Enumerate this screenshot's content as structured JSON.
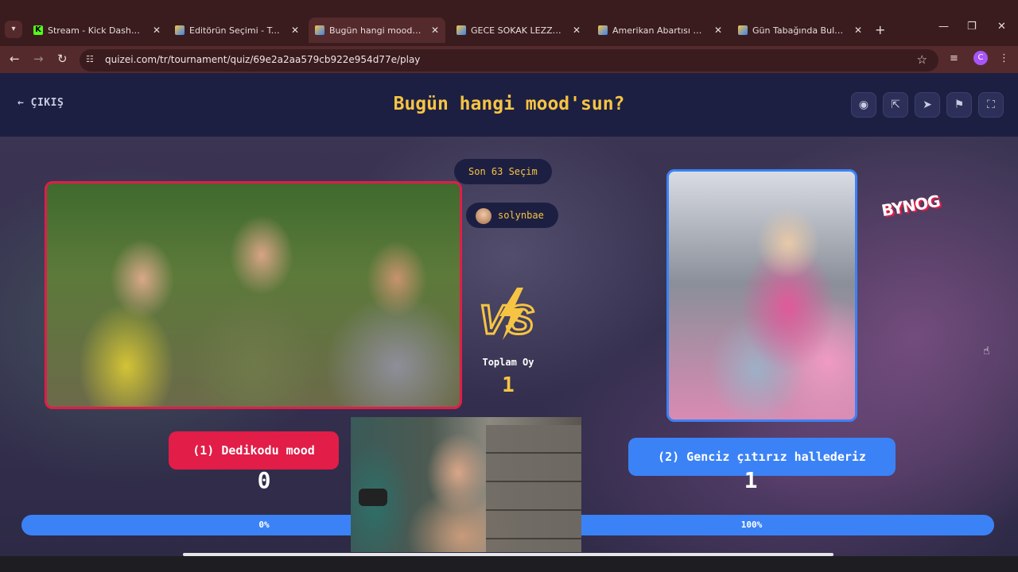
{
  "browser": {
    "tabs": [
      {
        "title": "Stream - Kick Dashboard",
        "favicon": "kick-icon"
      },
      {
        "title": "Editörün Seçimi - Turnuva",
        "favicon": "quizei-icon"
      },
      {
        "title": "Bugün hangi mood'sun? -",
        "favicon": "quizei-icon",
        "active": true
      },
      {
        "title": "GECE SOKAK LEZZETLERİ",
        "favicon": "quizei-icon"
      },
      {
        "title": "Amerikan Abartısı Yiyecekl",
        "favicon": "quizei-icon"
      },
      {
        "title": "Gün Tabağında Bulunan Le",
        "favicon": "quizei-icon"
      }
    ],
    "url": "quizei.com/tr/tournament/quiz/69e2a2aa579cb922e954d77e/play",
    "profile_initial": "C"
  },
  "header": {
    "exit_label": "ÇIKIŞ",
    "title": "Bugün hangi mood'sun?"
  },
  "info": {
    "recent_choices": "Son 63 Seçim",
    "user": "solynbae",
    "vs_text": "VS",
    "total_votes_label": "Toplam Oy",
    "total_votes": "1"
  },
  "options": {
    "left": {
      "label": "(1) Dedikodu mood",
      "votes": "0",
      "percent_label": "0%",
      "percent": 0
    },
    "right": {
      "label": "(2) Genciz çıtırız hallederiz",
      "votes": "1",
      "percent_label": "100%",
      "percent": 100
    }
  },
  "logo_text": "BYNOG",
  "colors": {
    "accent_yellow": "#f6c443",
    "left_red": "#e11d48",
    "right_blue": "#3b82f6",
    "page_bg": "#1d1f42"
  }
}
